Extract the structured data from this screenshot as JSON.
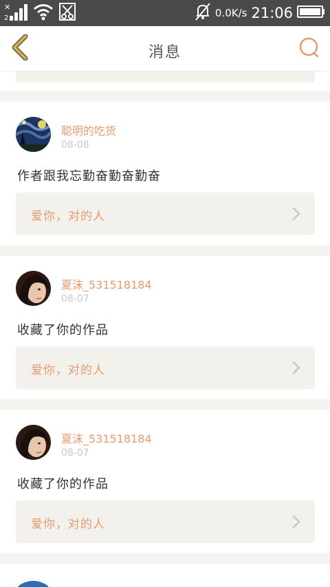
{
  "status_bar": {
    "network_speed": "0.0K/s",
    "time": "21:06",
    "icons": [
      "signal-icon",
      "wifi-icon",
      "scissors-icon",
      "mute-bell-icon",
      "battery-icon"
    ]
  },
  "header": {
    "title": "消息",
    "back_icon": "chevron-left-icon",
    "search_icon": "search-icon"
  },
  "colors": {
    "accent": "#e59a6f",
    "back_chevron": "#d6b13b",
    "background": "#f4f3ef",
    "card": "#ffffff",
    "ref_box": "#f2f1ec"
  },
  "messages": [
    {
      "username": "聪明的吃货",
      "date": "08-08",
      "text": "作者跟我忘勤奋勤奋勤奋",
      "ref_title": "爱你，对的人"
    },
    {
      "username": "夏沫_531518184",
      "date": "08-07",
      "text": "收藏了你的作品",
      "ref_title": "爱你，对的人"
    },
    {
      "username": "夏沫_531518184",
      "date": "08-07",
      "text": "收藏了你的作品",
      "ref_title": "爱你，对的人"
    }
  ]
}
